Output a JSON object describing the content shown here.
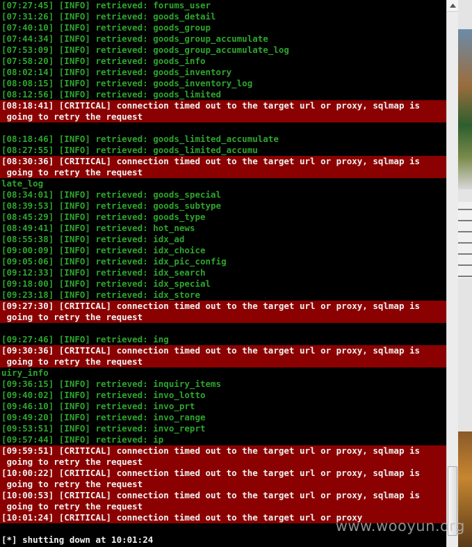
{
  "console": {
    "lines": [
      {
        "type": "info",
        "text": "[07:27:45] [INFO] retrieved: forums_user"
      },
      {
        "type": "info",
        "text": "[07:31:26] [INFO] retrieved: goods_detail"
      },
      {
        "type": "info",
        "text": "[07:40:10] [INFO] retrieved: goods_group"
      },
      {
        "type": "info",
        "text": "[07:44:34] [INFO] retrieved: goods_group_accumulate"
      },
      {
        "type": "info",
        "text": "[07:53:09] [INFO] retrieved: goods_group_accumulate_log"
      },
      {
        "type": "info",
        "text": "[07:58:20] [INFO] retrieved: goods_info"
      },
      {
        "type": "info",
        "text": "[08:02:14] [INFO] retrieved: goods_inventory"
      },
      {
        "type": "info",
        "text": "[08:08:15] [INFO] retrieved: goods_inventory_log"
      },
      {
        "type": "info",
        "text": "[08:12:56] [INFO] retrieved: goods_limited"
      },
      {
        "type": "crit",
        "text": "[08:18:41] [CRITICAL] connection timed out to the target url or proxy, sqlmap is"
      },
      {
        "type": "crit",
        "text": " going to retry the request"
      },
      {
        "type": "blank",
        "text": ""
      },
      {
        "type": "info",
        "text": "[08:18:46] [INFO] retrieved: goods_limited_accumulate"
      },
      {
        "type": "info",
        "text": "[08:27:55] [INFO] retrieved: goods_limited_accumu"
      },
      {
        "type": "crit",
        "text": "[08:30:36] [CRITICAL] connection timed out to the target url or proxy, sqlmap is"
      },
      {
        "type": "crit",
        "text": " going to retry the request"
      },
      {
        "type": "info",
        "text": "late_log"
      },
      {
        "type": "info",
        "text": "[08:34:01] [INFO] retrieved: goods_special"
      },
      {
        "type": "info",
        "text": "[08:39:53] [INFO] retrieved: goods_subtype"
      },
      {
        "type": "info",
        "text": "[08:45:29] [INFO] retrieved: goods_type"
      },
      {
        "type": "info",
        "text": "[08:49:41] [INFO] retrieved: hot_news"
      },
      {
        "type": "info",
        "text": "[08:55:38] [INFO] retrieved: idx_ad"
      },
      {
        "type": "info",
        "text": "[09:00:09] [INFO] retrieved: idx_choice"
      },
      {
        "type": "info",
        "text": "[09:05:06] [INFO] retrieved: idx_pic_config"
      },
      {
        "type": "info",
        "text": "[09:12:33] [INFO] retrieved: idx_search"
      },
      {
        "type": "info",
        "text": "[09:18:00] [INFO] retrieved: idx_special"
      },
      {
        "type": "info",
        "text": "[09:23:18] [INFO] retrieved: idx_store"
      },
      {
        "type": "crit",
        "text": "[09:27:30] [CRITICAL] connection timed out to the target url or proxy, sqlmap is"
      },
      {
        "type": "crit",
        "text": " going to retry the request"
      },
      {
        "type": "blank",
        "text": ""
      },
      {
        "type": "info",
        "text": "[09:27:46] [INFO] retrieved: ing"
      },
      {
        "type": "crit",
        "text": "[09:30:36] [CRITICAL] connection timed out to the target url or proxy, sqlmap is"
      },
      {
        "type": "crit",
        "text": " going to retry the request"
      },
      {
        "type": "info",
        "text": "uiry_info"
      },
      {
        "type": "info",
        "text": "[09:36:15] [INFO] retrieved: inquiry_items"
      },
      {
        "type": "info",
        "text": "[09:40:02] [INFO] retrieved: invo_lotto"
      },
      {
        "type": "info",
        "text": "[09:46:10] [INFO] retrieved: invo_prt"
      },
      {
        "type": "info",
        "text": "[09:49:20] [INFO] retrieved: invo_range"
      },
      {
        "type": "info",
        "text": "[09:53:51] [INFO] retrieved: invo_reprt"
      },
      {
        "type": "info",
        "text": "[09:57:44] [INFO] retrieved: ip"
      },
      {
        "type": "crit",
        "text": "[09:59:51] [CRITICAL] connection timed out to the target url or proxy, sqlmap is"
      },
      {
        "type": "crit",
        "text": " going to retry the request"
      },
      {
        "type": "crit",
        "text": "[10:00:22] [CRITICAL] connection timed out to the target url or proxy, sqlmap is"
      },
      {
        "type": "crit",
        "text": " going to retry the request"
      },
      {
        "type": "crit",
        "text": "[10:00:53] [CRITICAL] connection timed out to the target url or proxy, sqlmap is"
      },
      {
        "type": "crit",
        "text": " going to retry the request"
      },
      {
        "type": "crit",
        "text": "[10:01:24] [CRITICAL] connection timed out to the target url or proxy"
      },
      {
        "type": "blank",
        "text": ""
      },
      {
        "type": "plain",
        "text": "[*] shutting down at 10:01:24"
      }
    ]
  },
  "watermark": {
    "text": "www.wooyun.org"
  },
  "colors": {
    "background": "#000000",
    "info_text": "#2ea52e",
    "critical_background": "#8b0000",
    "critical_text": "#f2f2f2",
    "plain_text": "#f2f2f2"
  },
  "icons": {
    "scroll_up": "up-arrow-icon"
  }
}
